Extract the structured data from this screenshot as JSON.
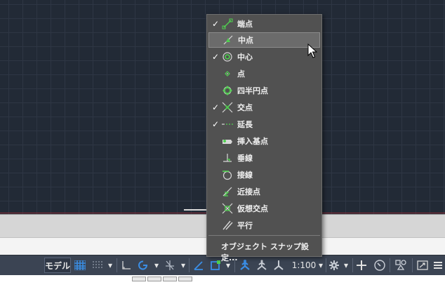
{
  "menu": {
    "items": [
      {
        "label": "端点",
        "checked": true,
        "icon": "endpoint-icon"
      },
      {
        "label": "中点",
        "checked": false,
        "icon": "midpoint-icon",
        "hover": true
      },
      {
        "label": "中心",
        "checked": true,
        "icon": "center-icon"
      },
      {
        "label": "点",
        "checked": false,
        "icon": "node-icon"
      },
      {
        "label": "四半円点",
        "checked": false,
        "icon": "quadrant-icon"
      },
      {
        "label": "交点",
        "checked": true,
        "icon": "intersection-icon"
      },
      {
        "label": "延長",
        "checked": true,
        "icon": "extension-icon"
      },
      {
        "label": "挿入基点",
        "checked": false,
        "icon": "insertion-icon"
      },
      {
        "label": "垂線",
        "checked": false,
        "icon": "perpendicular-icon"
      },
      {
        "label": "接線",
        "checked": false,
        "icon": "tangent-icon"
      },
      {
        "label": "近接点",
        "checked": false,
        "icon": "nearest-icon"
      },
      {
        "label": "仮想交点",
        "checked": false,
        "icon": "apparent-intersection-icon"
      },
      {
        "label": "平行",
        "checked": false,
        "icon": "parallel-icon"
      }
    ],
    "settings_label": "オブジェクト スナップ設定...",
    "check_glyph": "✓"
  },
  "statusbar": {
    "model_label": "モデル",
    "scale_label": "1:100",
    "dropdown_glyph": "▾"
  },
  "colors": {
    "canvas": "#222a36",
    "menu_bg": "#515151",
    "snap_green": "#4fd14f",
    "accent_blue": "#3a8ee6"
  }
}
